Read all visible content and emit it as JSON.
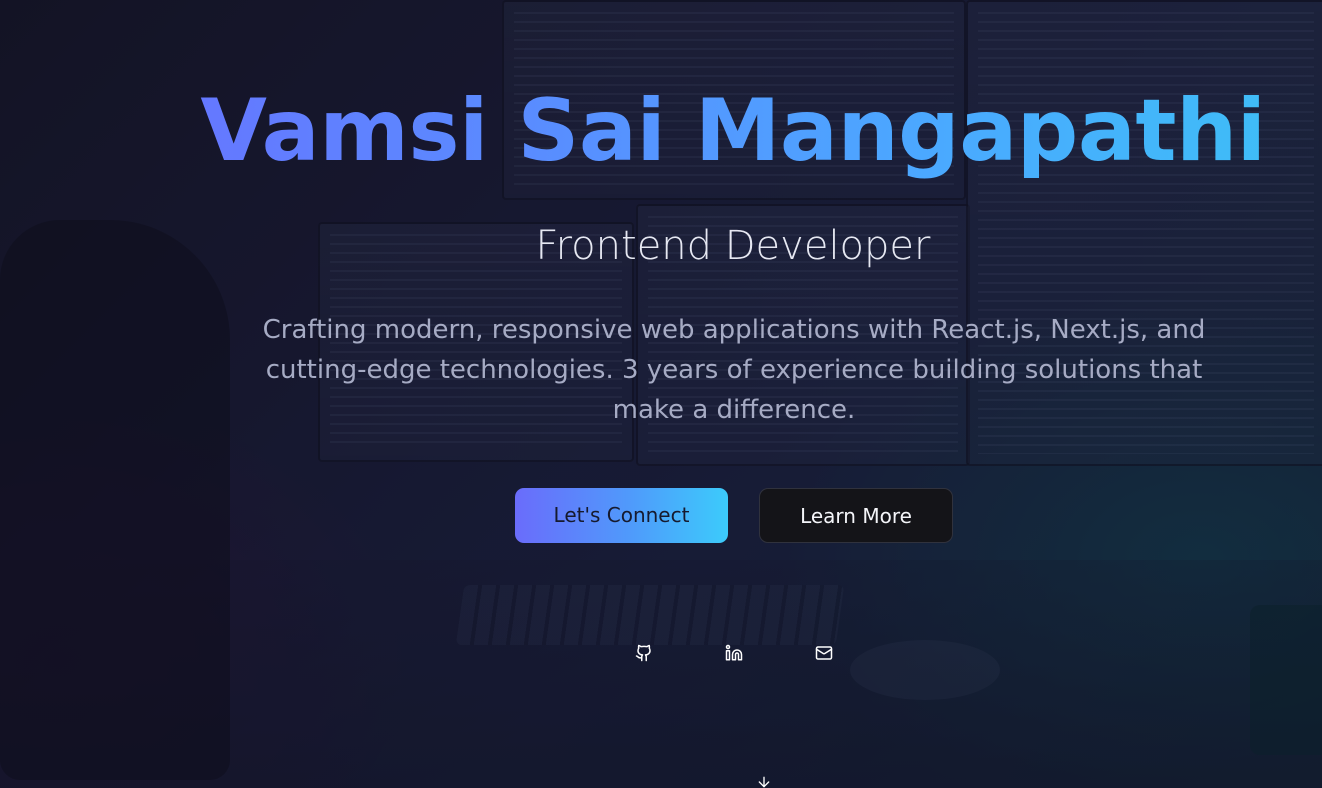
{
  "hero": {
    "name": "Vamsi Sai Mangapathi",
    "role": "Frontend Developer",
    "description": "Crafting modern, responsive web applications with React.js, Next.js, and cutting-edge technologies. 3 years of experience building solutions that make a difference."
  },
  "buttons": {
    "primary_label": "Let's Connect",
    "secondary_label": "Learn More"
  },
  "social": [
    {
      "icon": "github-icon"
    },
    {
      "icon": "linkedin-icon"
    },
    {
      "icon": "mail-icon"
    }
  ],
  "scroll_indicator": {
    "icon": "arrow-down-icon"
  },
  "colors": {
    "gradient_start": "#6b6cff",
    "gradient_end": "#38c8f2",
    "secondary_button_bg": "#141418",
    "description_text": "#a6abc4"
  }
}
